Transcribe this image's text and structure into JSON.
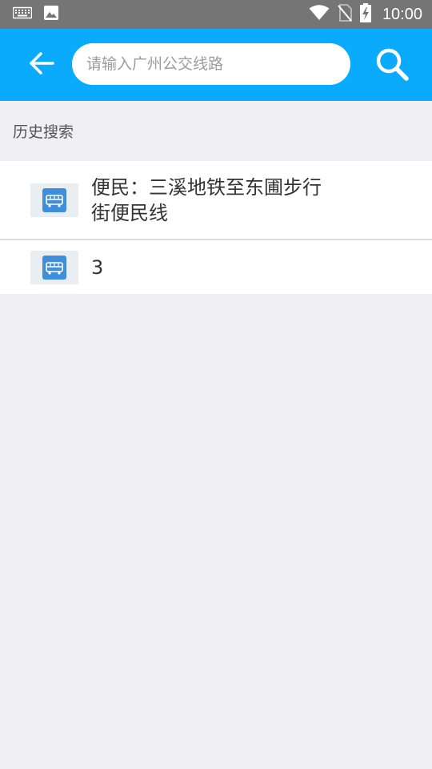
{
  "status_bar": {
    "time": "10:00",
    "icons": [
      "keyboard-icon",
      "image-icon",
      "wifi-icon",
      "no-sim-icon",
      "battery-charging-icon"
    ]
  },
  "header": {
    "search_placeholder": "请输入广州公交线路",
    "search_value": "",
    "back_icon": "arrow-left-icon",
    "search_icon": "search-icon",
    "background_color": "#0aabfc"
  },
  "history": {
    "title": "历史搜索",
    "items": [
      {
        "label": "便民：三溪地铁至东圃步行街便民线",
        "icon": "bus-icon"
      },
      {
        "label": "3",
        "icon": "bus-icon"
      }
    ]
  }
}
